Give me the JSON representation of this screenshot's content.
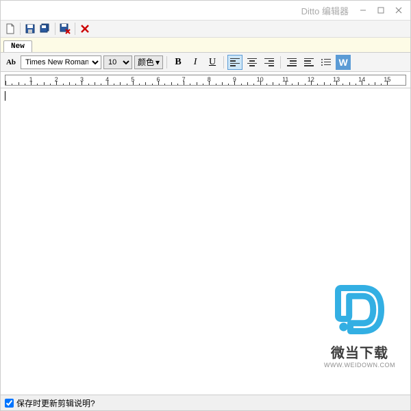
{
  "window": {
    "title": "Ditto 编辑器"
  },
  "tabs": {
    "active": "New"
  },
  "font": {
    "family": "Times New Roman",
    "size": "10"
  },
  "color": {
    "label": "颜色"
  },
  "format": {
    "bold": "B",
    "italic": "I",
    "underline": "U",
    "wrap": "W",
    "ab": "Ab"
  },
  "statusbar": {
    "checkbox_label": "保存时更新剪辑说明?"
  },
  "watermark": {
    "line1": "微当下载",
    "line2": "WWW.WEIDOWN.COM"
  },
  "ruler": {
    "min": 1,
    "max": 15
  }
}
